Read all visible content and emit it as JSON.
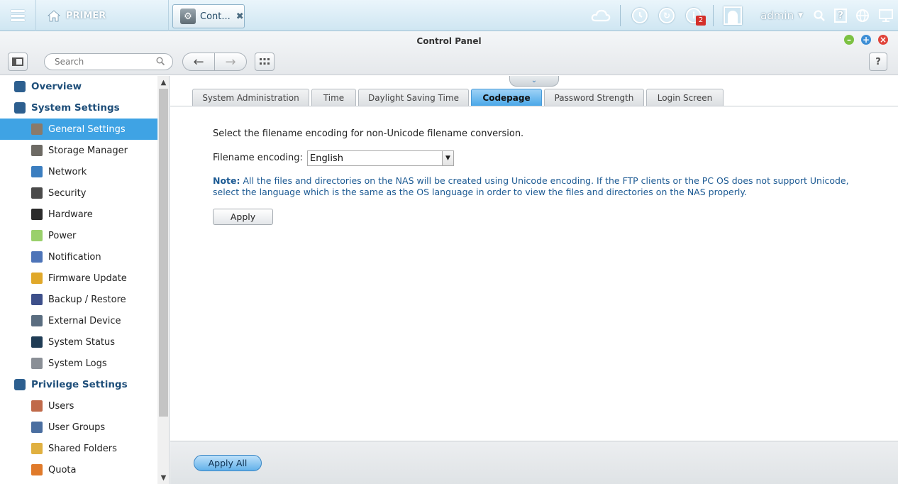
{
  "taskbar": {
    "home_label": "PRIMER",
    "open_app_label": "Cont...",
    "notification_count": "2",
    "user_name": "admin",
    "help_glyph": "?"
  },
  "window": {
    "title": "Control Panel",
    "search_placeholder": "Search",
    "help_label": "?"
  },
  "sidebar": {
    "items": [
      {
        "label": "Overview",
        "kind": "section",
        "icon": "overview-icon",
        "color": "#2d5f8f"
      },
      {
        "label": "System Settings",
        "kind": "section",
        "icon": "gear-icon",
        "color": "#2d5f8f"
      },
      {
        "label": "General Settings",
        "kind": "sub",
        "icon": "general-settings-icon",
        "color": "#8a7a6a",
        "active": true
      },
      {
        "label": "Storage Manager",
        "kind": "sub",
        "icon": "storage-icon",
        "color": "#6d6a64"
      },
      {
        "label": "Network",
        "kind": "sub",
        "icon": "network-icon",
        "color": "#3b7ec0"
      },
      {
        "label": "Security",
        "kind": "sub",
        "icon": "lock-icon",
        "color": "#4a4a4a"
      },
      {
        "label": "Hardware",
        "kind": "sub",
        "icon": "hardware-icon",
        "color": "#2b2b2b"
      },
      {
        "label": "Power",
        "kind": "sub",
        "icon": "power-icon",
        "color": "#9ad06b"
      },
      {
        "label": "Notification",
        "kind": "sub",
        "icon": "notification-icon",
        "color": "#4d74b8"
      },
      {
        "label": "Firmware Update",
        "kind": "sub",
        "icon": "firmware-icon",
        "color": "#e0a82a"
      },
      {
        "label": "Backup / Restore",
        "kind": "sub",
        "icon": "backup-icon",
        "color": "#3d4f8a"
      },
      {
        "label": "External Device",
        "kind": "sub",
        "icon": "external-device-icon",
        "color": "#5a6d80"
      },
      {
        "label": "System Status",
        "kind": "sub",
        "icon": "monitor-icon",
        "color": "#1f3c55"
      },
      {
        "label": "System Logs",
        "kind": "sub",
        "icon": "logs-icon",
        "color": "#8a8f96"
      },
      {
        "label": "Privilege Settings",
        "kind": "section",
        "icon": "user-icon",
        "color": "#2d5f8f"
      },
      {
        "label": "Users",
        "kind": "sub",
        "icon": "users-icon",
        "color": "#c06a4a"
      },
      {
        "label": "User Groups",
        "kind": "sub",
        "icon": "user-groups-icon",
        "color": "#4a6ea0"
      },
      {
        "label": "Shared Folders",
        "kind": "sub",
        "icon": "folder-icon",
        "color": "#e0b040"
      },
      {
        "label": "Quota",
        "kind": "sub",
        "icon": "quota-icon",
        "color": "#e07a2a"
      }
    ]
  },
  "tabs": [
    {
      "label": "System Administration",
      "active": false
    },
    {
      "label": "Time",
      "active": false
    },
    {
      "label": "Daylight Saving Time",
      "active": false
    },
    {
      "label": "Codepage",
      "active": true
    },
    {
      "label": "Password Strength",
      "active": false
    },
    {
      "label": "Login Screen",
      "active": false
    }
  ],
  "codepage": {
    "description": "Select the filename encoding for non-Unicode filename conversion.",
    "encoding_label": "Filename encoding:",
    "encoding_value": "English",
    "note_label": "Note:",
    "note_text": " All the files and directories on the NAS will be created using Unicode encoding. If the FTP clients or the PC OS does not support Unicode, select the language which is the same as the OS language in order to view the files and directories on the NAS properly.",
    "apply_label": "Apply"
  },
  "footer": {
    "apply_all_label": "Apply All"
  }
}
